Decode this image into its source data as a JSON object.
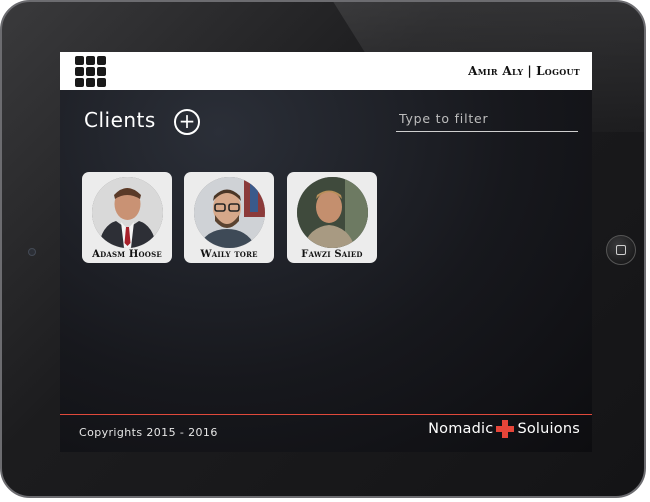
{
  "header": {
    "user_name": "Amir Aly",
    "separator": "|",
    "logout_label": "Logout"
  },
  "clients": {
    "title": "Clients",
    "add_symbol": "+",
    "filter_placeholder": "Type to filter",
    "items": [
      {
        "name": "Adasm Hoose",
        "avatar": "man-in-suit-portrait"
      },
      {
        "name": "Waily tore",
        "avatar": "man-with-glasses-portrait"
      },
      {
        "name": "Fawzi Saied",
        "avatar": "man-outdoors-portrait"
      }
    ]
  },
  "footer": {
    "copyright": "Copyrights  2015 - 2016",
    "brand_left": "Nomadic",
    "brand_right": "Soluions",
    "accent_color": "#e64539"
  }
}
